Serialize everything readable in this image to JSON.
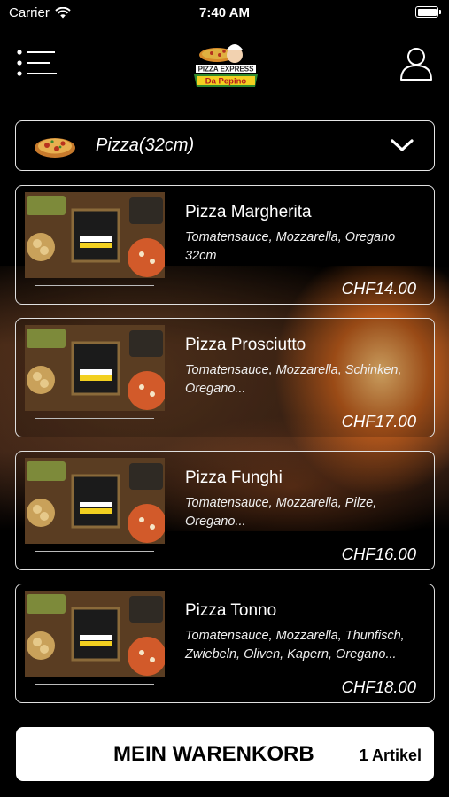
{
  "status_bar": {
    "carrier": "Carrier",
    "time": "7:40 AM"
  },
  "header": {
    "logo_text_top": "PIZZA EXPRESS",
    "logo_text_bottom": "Da Pepino"
  },
  "category": {
    "selected": "Pizza(32cm)"
  },
  "products": [
    {
      "name": "Pizza Margherita",
      "description": "Tomatensauce, Mozzarella, Oregano 32cm",
      "price": "CHF14.00"
    },
    {
      "name": "Pizza Prosciutto",
      "description": "Tomatensauce, Mozzarella, Schinken, Oregano...",
      "price": "CHF17.00"
    },
    {
      "name": "Pizza Funghi",
      "description": "Tomatensauce, Mozzarella, Pilze, Oregano...",
      "price": "CHF16.00"
    },
    {
      "name": "Pizza Tonno",
      "description": "Tomatensauce, Mozzarella, Thunfisch, Zwiebeln, Oliven, Kapern, Oregano...",
      "price": "CHF18.00"
    }
  ],
  "cart": {
    "label": "MEIN WARENKORB",
    "count": "1 Artikel"
  }
}
